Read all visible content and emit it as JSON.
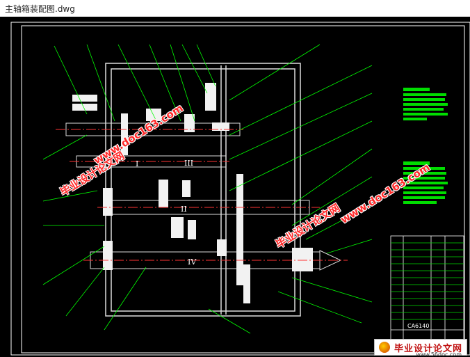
{
  "window": {
    "title": "主轴箱装配图.dwg"
  },
  "drawing": {
    "roman_labels": [
      "I",
      "II",
      "III",
      "IV"
    ],
    "title_block_code": "CA6140"
  },
  "watermarks": {
    "site": "www.doc163.com",
    "cn": "毕业设计论文网"
  },
  "footer": {
    "logo_text": "毕业设计论文网",
    "url": "www.56doc.com"
  },
  "colors": {
    "background": "#000000",
    "frame": "#ffffff",
    "leader": "#00ff00",
    "centerline": "#ff3333",
    "hatch": "#ffffff",
    "watermark": "#ff2a2a"
  }
}
